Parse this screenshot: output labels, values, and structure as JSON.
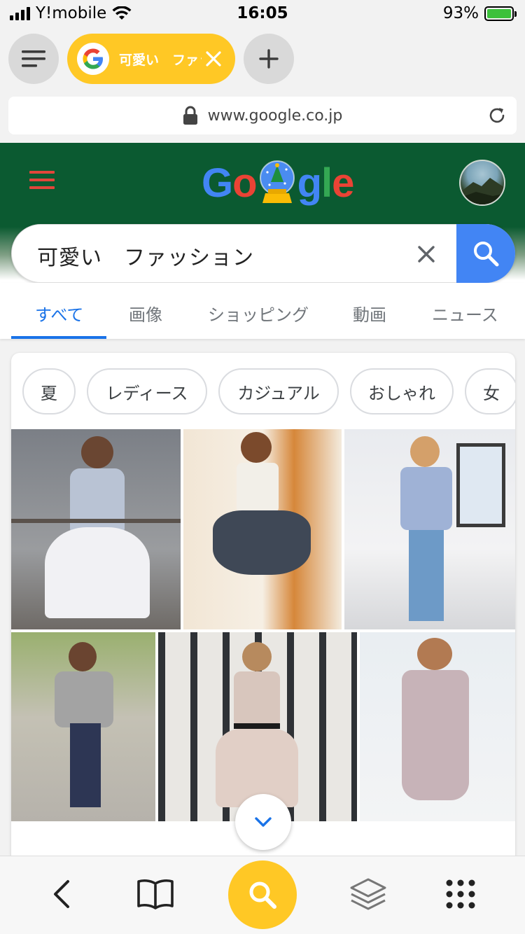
{
  "status": {
    "carrier": "Y!mobile",
    "time": "16:05",
    "battery": "93%"
  },
  "tab": {
    "title": "可愛い　ファッション"
  },
  "url": {
    "host": "www.google.co.jp"
  },
  "search": {
    "query": "可愛い　ファッション"
  },
  "nav_tabs": [
    {
      "label": "すべて",
      "active": true
    },
    {
      "label": "画像"
    },
    {
      "label": "ショッピング"
    },
    {
      "label": "動画"
    },
    {
      "label": "ニュース"
    }
  ],
  "chips": [
    "夏",
    "レディース",
    "カジュアル",
    "おしゃれ",
    "女"
  ],
  "colors": {
    "accent_yellow": "#ffc825",
    "google_blue": "#4285f4",
    "header_green": "#0b5a31",
    "tab_active": "#1a73e8"
  },
  "icons": {
    "tabs_menu": "menu-icon",
    "new_tab": "plus-icon",
    "lock": "lock-icon",
    "reload": "reload-icon",
    "back": "chevron-left-icon",
    "bookmarks": "book-icon",
    "search": "search-icon",
    "tabs": "layers-icon",
    "more": "grid-dots-icon",
    "expand": "chevron-down-icon"
  }
}
